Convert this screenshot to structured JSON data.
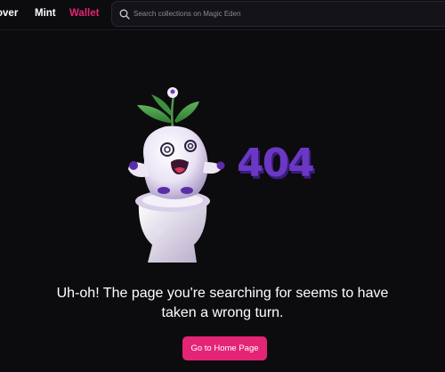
{
  "nav": {
    "items": [
      {
        "label": "over"
      },
      {
        "label": "Mint"
      },
      {
        "label": "Wallet"
      }
    ]
  },
  "search": {
    "placeholder": "Search collections on Magic Eden",
    "icon": "search-icon"
  },
  "error": {
    "code": "404",
    "message_line1": "Uh-oh! The page you're searching for seems to have",
    "message_line2": "taken a wrong turn."
  },
  "home_button": {
    "label": "Go to Home Page"
  },
  "colors": {
    "background": "#0c0b0e",
    "accent": "#e42575",
    "purple": "#5b2ea8"
  }
}
